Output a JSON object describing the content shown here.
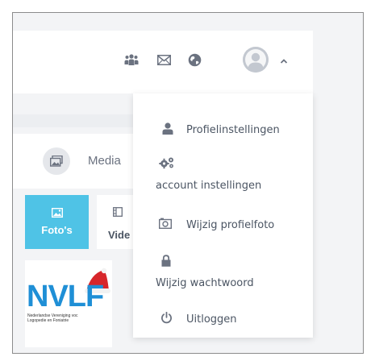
{
  "header": {
    "icons": [
      "users-icon",
      "mail-icon",
      "globe-icon",
      "avatar",
      "chevron-up-icon"
    ]
  },
  "content": {
    "media_label": "Media",
    "tabs": [
      {
        "label": "Foto's",
        "active": true
      },
      {
        "label": "Vide",
        "active": false
      }
    ],
    "thumbnail": {
      "logo_text": "NVLF",
      "logo_subtitle_line1": "Nederlandse Vereniging voc",
      "logo_subtitle_line2": "Logopedie en Foniatrie"
    }
  },
  "dropdown": {
    "items": [
      {
        "label": "Profielinstellingen",
        "icon": "user-icon"
      },
      {
        "label": "account instellingen",
        "icon": "gears-icon"
      },
      {
        "label": "Wijzig profielfoto",
        "icon": "camera-icon"
      },
      {
        "label": "Wijzig wachtwoord",
        "icon": "lock-icon"
      },
      {
        "label": "Uitloggen",
        "icon": "power-icon"
      }
    ]
  },
  "colors": {
    "accent": "#4fc3e6",
    "logo_blue": "#1f8fd6",
    "icon_gray": "#6b7280",
    "background": "#f3f4f6"
  }
}
